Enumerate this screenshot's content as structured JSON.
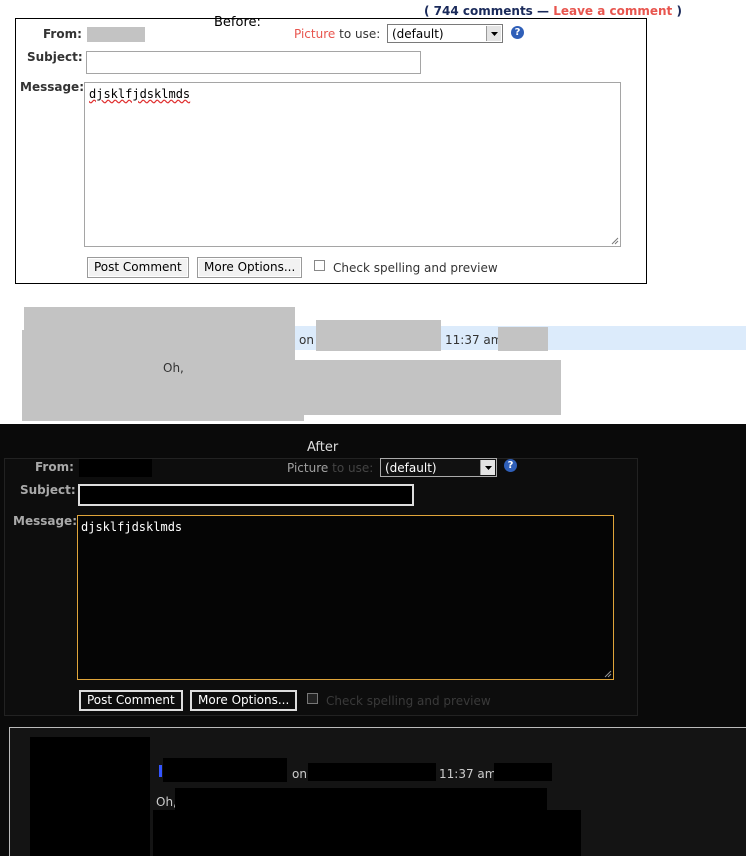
{
  "before": {
    "comments_link": {
      "open": "(",
      "count": "744 comments",
      "dash": "—",
      "leave": "Leave a comment",
      "close": ")"
    },
    "heading": "Before:",
    "from_label": "From:",
    "subject_label": "Subject:",
    "message_label": "Message:",
    "picture_word": "Picture",
    "to_use": "to use:",
    "picture_select": "(default)",
    "help_glyph": "?",
    "subject_value": "",
    "message_value": "djsklfjdsklmds",
    "post_button": "Post Comment",
    "more_button": "More Options...",
    "check_label": "Check spelling and preview",
    "comment": {
      "on": "on",
      "time": "11:37 am",
      "body": "Oh,"
    }
  },
  "after": {
    "heading": "After",
    "from_label": "From:",
    "subject_label": "Subject:",
    "message_label": "Message:",
    "picture_word": "Picture",
    "to_use": "to use:",
    "picture_select": "(default)",
    "help_glyph": "?",
    "subject_value": "",
    "message_value": "djsklfjdsklmds",
    "post_button": "Post Comment",
    "more_button": "More Options...",
    "check_label": "Check spelling and preview",
    "comment": {
      "on": "on",
      "time": "11:37 am",
      "body": "Oh,"
    }
  },
  "colors": {
    "link_red": "#e8554e",
    "link_navy": "#1a2a5a",
    "comment_highlight": "#dcebfb",
    "redaction_gray": "#c3c3c3",
    "after_focus_border": "#e0a53a"
  }
}
